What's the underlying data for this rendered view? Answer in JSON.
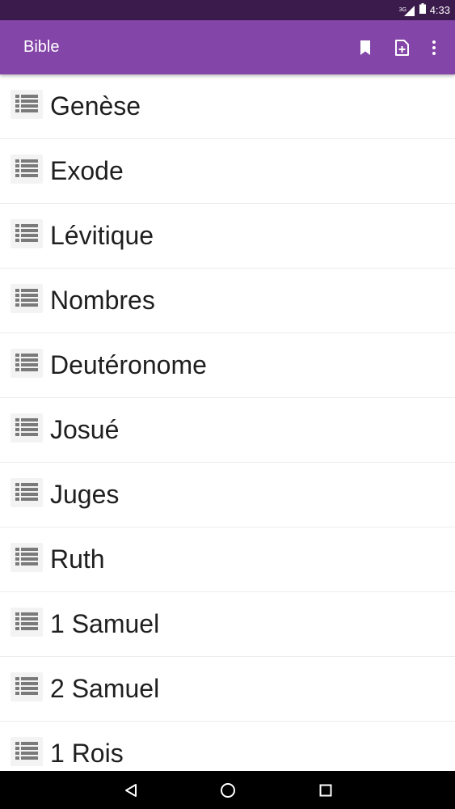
{
  "status_bar": {
    "network_label": "3G",
    "time": "4:33"
  },
  "app_bar": {
    "title": "Bible",
    "actions": [
      {
        "icon": "bookmark-icon"
      },
      {
        "icon": "add-note-icon"
      },
      {
        "icon": "more-vert-icon"
      }
    ]
  },
  "books": [
    {
      "name": "Genèse",
      "icon": "list-icon"
    },
    {
      "name": "Exode",
      "icon": "list-icon"
    },
    {
      "name": "Lévitique",
      "icon": "list-icon"
    },
    {
      "name": "Nombres",
      "icon": "list-icon"
    },
    {
      "name": "Deutéronome",
      "icon": "list-icon"
    },
    {
      "name": "Josué",
      "icon": "list-icon"
    },
    {
      "name": "Juges",
      "icon": "list-icon"
    },
    {
      "name": "Ruth",
      "icon": "list-icon"
    },
    {
      "name": "1 Samuel",
      "icon": "list-icon"
    },
    {
      "name": "2 Samuel",
      "icon": "list-icon"
    },
    {
      "name": "1 Rois",
      "icon": "list-icon"
    }
  ],
  "nav_bar": {
    "buttons": [
      {
        "icon": "back-icon"
      },
      {
        "icon": "home-icon"
      },
      {
        "icon": "recents-icon"
      }
    ]
  },
  "colors": {
    "status_bar": "#3b1a4c",
    "app_bar": "#8445a8",
    "text": "#1f1f1f",
    "icon_gray": "#7a7a7a"
  }
}
